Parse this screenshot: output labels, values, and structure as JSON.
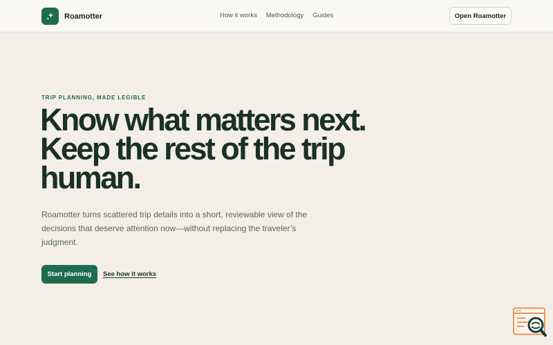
{
  "brand": {
    "name": "Roamotter",
    "logo_icon": "sparkle-icon",
    "accent": "#1f6b52"
  },
  "nav": {
    "items": [
      "How it works",
      "Methodology",
      "Guides"
    ]
  },
  "header": {
    "open_button": "Open Roamotter"
  },
  "hero": {
    "eyebrow": "TRIP PLANNING, MADE LEGIBLE",
    "headline_lines": [
      "Know what matters next.",
      "Keep the rest of the trip",
      "human."
    ],
    "lead": "Roamotter turns scattered trip details into a short, reviewable view of the decisions that deserve attention now—without replacing the traveler’s judgment.",
    "primary_cta": "Start planning",
    "secondary_cta": "See how it works"
  },
  "widget": {
    "icon": "search-feedback-icon",
    "color": "#e8975a"
  }
}
